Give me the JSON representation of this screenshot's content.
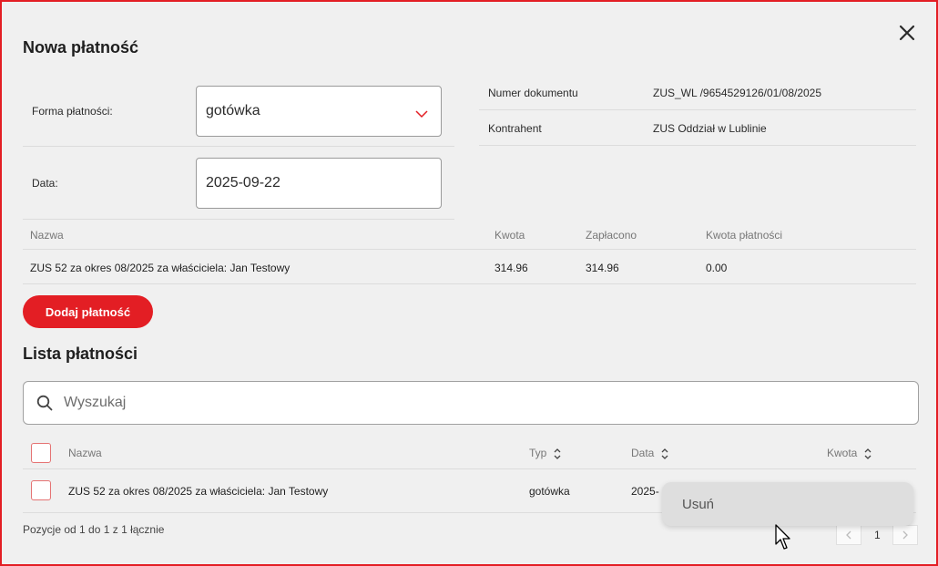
{
  "dialog": {
    "title": "Nowa płatność",
    "close_icon": "close-icon"
  },
  "form": {
    "payment_form_label": "Forma płatności:",
    "payment_form_value": "gotówka",
    "date_label": "Data:",
    "date_value": "2025-09-22"
  },
  "document": {
    "number_label": "Numer dokumentu",
    "number_value": "ZUS_WL /9654529126/01/08/2025",
    "contractor_label": "Kontrahent",
    "contractor_value": "ZUS Oddział w Lublinie"
  },
  "summary_table": {
    "headers": [
      "Nazwa",
      "Kwota",
      "Zapłacono",
      "Kwota płatności"
    ],
    "rows": [
      [
        "ZUS 52 za okres 08/2025 za właściciela: Jan Testowy",
        "314.96",
        "314.96",
        "0.00"
      ]
    ]
  },
  "add_button_label": "Dodaj płatność",
  "payments_list": {
    "title": "Lista płatności",
    "search_placeholder": "Wyszukaj",
    "headers": {
      "name": "Nazwa",
      "type": "Typ",
      "date": "Data",
      "amount": "Kwota"
    },
    "rows": [
      {
        "name": "ZUS 52 za okres 08/2025 za właściciela: Jan Testowy",
        "type": "gotówka",
        "date": "2025-"
      }
    ],
    "footer": "Pozycje od 1 do 1 z 1 łącznie",
    "page": "1"
  },
  "context_menu": {
    "delete_label": "Usuń"
  },
  "colors": {
    "accent": "#e31e24",
    "background": "#f0f0f0"
  }
}
